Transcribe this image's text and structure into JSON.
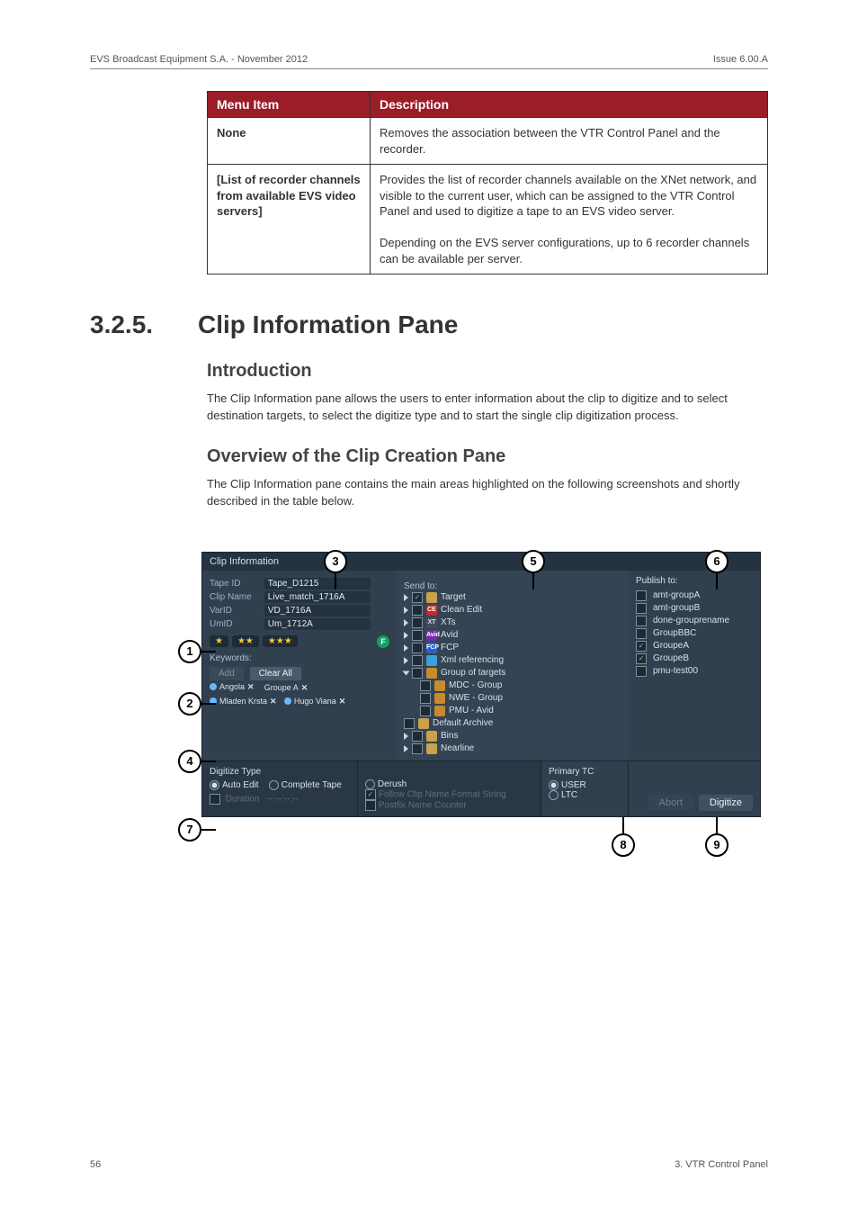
{
  "header": {
    "left": "EVS Broadcast Equipment S.A. - November 2012",
    "right": "Issue 6.00.A"
  },
  "table": {
    "headers": {
      "c0": "Menu Item",
      "c1": "Description"
    },
    "rows": [
      {
        "c0": "None",
        "c1": "Removes the association between the VTR Control Panel and the recorder."
      },
      {
        "c0": "[List of recorder channels from available EVS video servers]",
        "c1": "Provides the list of recorder channels available on the XNet network, and visible to the current user, which can be assigned to the VTR Control Panel and used to digitize a tape to an EVS video server.",
        "c1b": "Depending on the EVS server configurations, up to 6 recorder channels can be available per server."
      }
    ]
  },
  "section": {
    "num": "3.2.5.",
    "title": "Clip Information Pane"
  },
  "intro_h": "Introduction",
  "intro_p": "The Clip Information pane allows the users to enter information about the clip to digitize and to select destination targets, to select the digitize type and to start the single clip digitization process.",
  "ovw_h": "Overview of the Clip Creation Pane",
  "ovw_p": "The Clip Information pane contains the main areas highlighted on the following screenshots and shortly described in the table below.",
  "callouts": {
    "c1": "1",
    "c2": "2",
    "c3": "3",
    "c4": "4",
    "c5": "5",
    "c6": "6",
    "c7": "7",
    "c8": "8",
    "c9": "9"
  },
  "shot": {
    "title": "Clip Information",
    "fields": {
      "tape_id_l": "Tape ID",
      "tape_id_v": "Tape_D1215",
      "clip_name_l": "Clip Name",
      "clip_name_v": "Live_match_1716A",
      "varid_l": "VarID",
      "varid_v": "VD_1716A",
      "umid_l": "UmID",
      "umid_v": "Um_1712A"
    },
    "stars": {
      "s1": "★",
      "s2": "★★",
      "s3": "★★★",
      "f": "F"
    },
    "kw_h": "Keywords:",
    "btn_add": "Add",
    "btn_clear": "Clear All",
    "kw": {
      "k1": "Angola",
      "k2": "Groupe A",
      "k3": "Mladen Krsta",
      "k4": "Hugo Viana"
    },
    "send_h": "Send to:",
    "send": {
      "target": "Target",
      "clean": "Clean Edit",
      "xts": "XTs",
      "avid": "Avid",
      "fcp": "FCP",
      "xml": "Xml referencing",
      "grp": "Group of targets",
      "mdc": "MDC - Group",
      "nwe": "NWE - Group",
      "pmu": "PMU - Avid",
      "def": "Default Archive",
      "bins": "Bins",
      "near": "Nearline"
    },
    "pub_h": "Publish to:",
    "pub": {
      "a": "amt-groupA",
      "b": "amt-groupB",
      "c": "done-grouprename",
      "d": "GroupBBC",
      "e": "GroupeA",
      "f": "GroupeB",
      "g": "pmu-test00"
    },
    "digi": {
      "type_h": "Digitize Type",
      "auto": "Auto Edit",
      "complete": "Complete Tape",
      "derush": "Derush",
      "duration_l": "Duration",
      "duration_v": "--:--:--;--",
      "follow": "Follow Clip Name Format String",
      "postfix": "Postfix Name Counter",
      "tc_h": "Primary TC",
      "user": "USER",
      "ltc": "LTC",
      "abort": "Abort",
      "digitize": "Digitize"
    }
  },
  "footer": {
    "page": "56",
    "right": "3. VTR Control Panel"
  }
}
